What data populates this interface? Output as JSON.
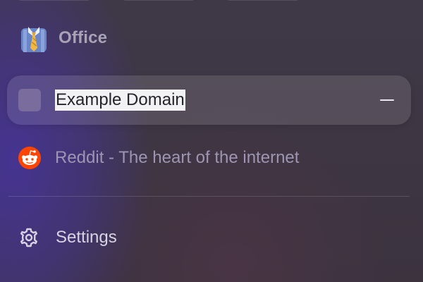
{
  "space": {
    "title": "Office",
    "icon": "necktie-icon"
  },
  "tabs": [
    {
      "title": "Example Domain",
      "icon": "blank-favicon",
      "state": "active",
      "close_icon": "minus-icon"
    },
    {
      "title": "Reddit - The heart of the internet",
      "icon": "reddit-icon",
      "state": "inactive"
    }
  ],
  "settings": {
    "label": "Settings",
    "icon": "gear-icon"
  },
  "colors": {
    "accent": "#7a6c9d",
    "reddit": "#ff4500"
  }
}
